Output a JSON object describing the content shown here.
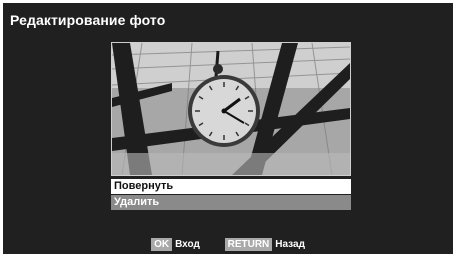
{
  "header": {
    "title": "Редактирование фото"
  },
  "photo": {
    "subject": "clock-image"
  },
  "menu": {
    "items": [
      {
        "label": "Повернуть",
        "selected": true
      },
      {
        "label": "Удалить",
        "selected": false
      }
    ]
  },
  "footer": {
    "hints": [
      {
        "key": "OK",
        "label": "Вход"
      },
      {
        "key": "RETURN",
        "label": "Назад"
      }
    ]
  },
  "colors": {
    "background": "#202020",
    "selected_bg": "#ffffff",
    "item_bg": "#8a8a8a",
    "key_bg": "#a9a9a9"
  }
}
